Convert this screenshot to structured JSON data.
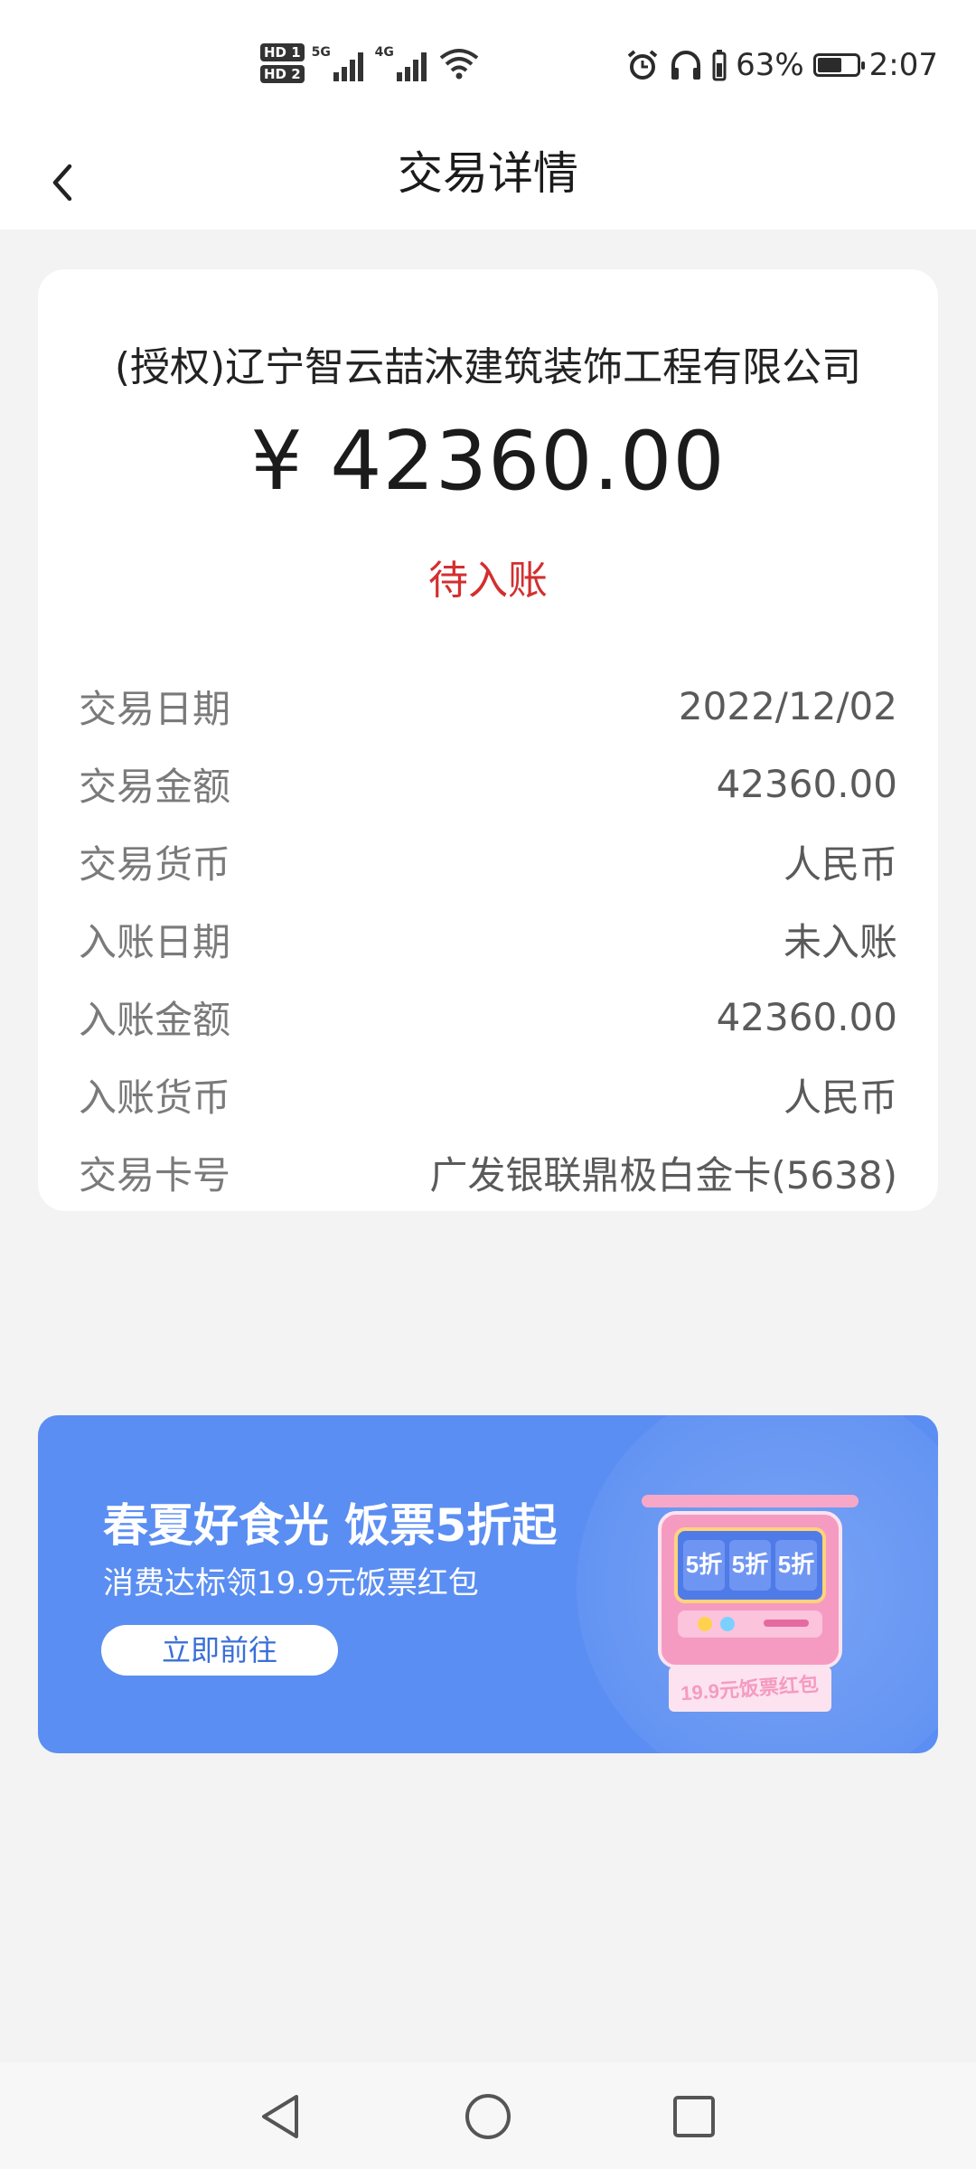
{
  "status_bar": {
    "hd1": "HD 1",
    "hd2": "HD 2",
    "net1": "5G",
    "net2": "4G",
    "battery_percent": "63%",
    "battery_level": 0.63,
    "time": "2:07",
    "icons": [
      "alarm-icon",
      "headphones-icon",
      "battery-icon",
      "wifi-icon",
      "signal-icon"
    ]
  },
  "header": {
    "title": "交易详情",
    "back_icon": "chevron-left-icon"
  },
  "transaction": {
    "merchant": "(授权)辽宁智云喆沐建筑装饰工程有限公司",
    "amount": "¥ 42360.00",
    "status": "待入账",
    "status_color": "#d32f2f",
    "details": [
      {
        "label": "交易日期",
        "value": "2022/12/02"
      },
      {
        "label": "交易金额",
        "value": "42360.00"
      },
      {
        "label": "交易货币",
        "value": "人民币"
      },
      {
        "label": "入账日期",
        "value": "未入账"
      },
      {
        "label": "入账金额",
        "value": "42360.00"
      },
      {
        "label": "入账货币",
        "value": "人民币"
      },
      {
        "label": "交易卡号",
        "value": "广发银联鼎极白金卡(5638)"
      }
    ]
  },
  "banner": {
    "title": "春夏好食光 饭票5折起",
    "subtitle": "消费达标领19.9元饭票红包",
    "button_label": "立即前往",
    "machine_labels": [
      "5折",
      "5折",
      "5折"
    ],
    "ticket_text": "19.9元饭票红包",
    "background_color": "#5b8ef2"
  },
  "nav_bar": {
    "icons": [
      "back-triangle-icon",
      "home-circle-icon",
      "recents-square-icon"
    ]
  }
}
